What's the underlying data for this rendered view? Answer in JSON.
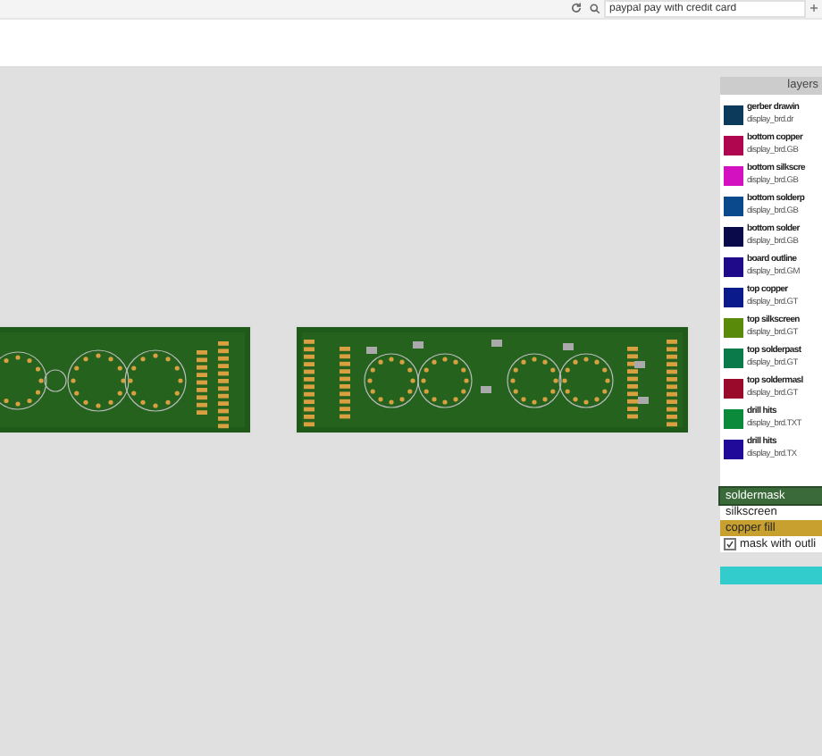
{
  "browser": {
    "search": {
      "value": "paypal pay with credit card"
    }
  },
  "layers_panel": {
    "title": "layers",
    "layers": [
      {
        "name": "gerber drawin",
        "file": "display_brd.dr",
        "color": "#0b3a5a"
      },
      {
        "name": "bottom copper",
        "file": "display_brd.GB",
        "color": "#b0064f"
      },
      {
        "name": "bottom silkscre",
        "file": "display_brd.GB",
        "color": "#d411c0"
      },
      {
        "name": "bottom solderp",
        "file": "display_brd.GB",
        "color": "#0a4a8c"
      },
      {
        "name": "bottom solder",
        "file": "display_brd.GB",
        "color": "#0a0a4a"
      },
      {
        "name": "board outline",
        "file": "display_brd.GM",
        "color": "#1f0a8a"
      },
      {
        "name": "top copper",
        "file": "display_brd.GT",
        "color": "#0a1a8a"
      },
      {
        "name": "top silkscreen",
        "file": "display_brd.GT",
        "color": "#5a8a0a"
      },
      {
        "name": "top solderpast",
        "file": "display_brd.GT",
        "color": "#0a7a4a"
      },
      {
        "name": "top soldermasl",
        "file": "display_brd.GT",
        "color": "#9a0a2a"
      },
      {
        "name": "drill hits",
        "file": "display_brd.TXT",
        "color": "#0a8a3a"
      },
      {
        "name": "drill hits",
        "file": "display_brd.TX",
        "color": "#1f0a9a"
      }
    ],
    "modes": [
      {
        "label": "soldermask",
        "selected": true,
        "color": "#3a6a3a"
      },
      {
        "label": "silkscreen",
        "selected": false,
        "color": "#ffffff"
      },
      {
        "label": "copper fill",
        "selected": false,
        "color": "#c8a030"
      }
    ],
    "mask_option": {
      "label": "mask with outli",
      "checked": true
    }
  }
}
